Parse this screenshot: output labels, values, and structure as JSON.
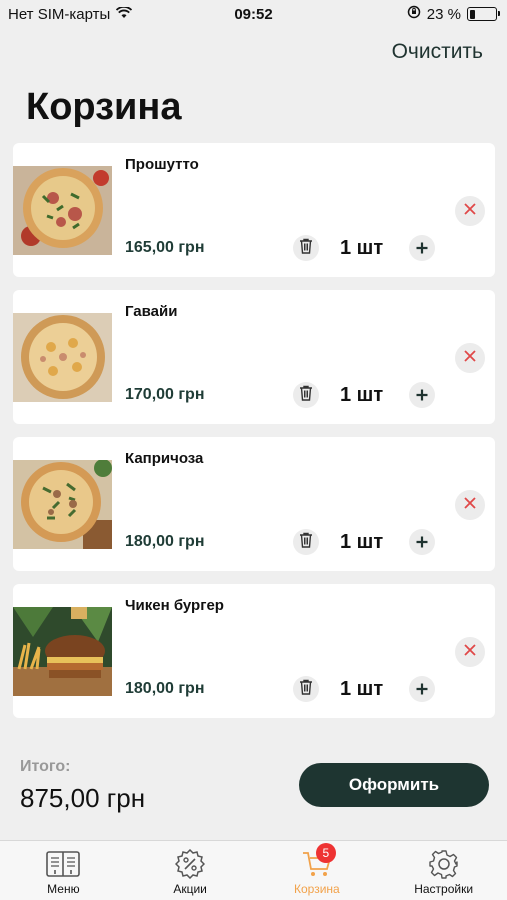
{
  "status_bar": {
    "carrier": "Нет SIM-карты",
    "time": "09:52",
    "battery_percent": "23 %",
    "battery_level": 0.23
  },
  "header": {
    "clear_label": "Очистить",
    "title": "Корзина"
  },
  "items": [
    {
      "name": "Прошутто",
      "price": "165,00 грн",
      "qty": "1 шт",
      "image_icon": "pizza-prosciutto-photo"
    },
    {
      "name": "Гавайи",
      "price": "170,00 грн",
      "qty": "1 шт",
      "image_icon": "pizza-hawaii-photo"
    },
    {
      "name": "Капричоза",
      "price": "180,00 грн",
      "qty": "1 шт",
      "image_icon": "pizza-capricciosa-photo"
    },
    {
      "name": "Чикен бургер",
      "price": "180,00 грн",
      "qty": "1 шт",
      "image_icon": "chicken-burger-photo"
    }
  ],
  "summary": {
    "total_label": "Итого:",
    "total_value": "875,00 грн",
    "checkout_label": "Оформить"
  },
  "tabbar": {
    "tabs": [
      {
        "label": "Меню",
        "icon": "menu-book-icon"
      },
      {
        "label": "Акции",
        "icon": "discount-icon"
      },
      {
        "label": "Корзина",
        "icon": "cart-icon",
        "badge": "5",
        "active": true
      },
      {
        "label": "Настройки",
        "icon": "gear-icon"
      }
    ]
  },
  "colors": {
    "accent_dark": "#1e3531",
    "price_green": "#1f3c36",
    "active_tab": "#f2a24a",
    "remove_x": "#e04848",
    "badge": "#e33333"
  }
}
